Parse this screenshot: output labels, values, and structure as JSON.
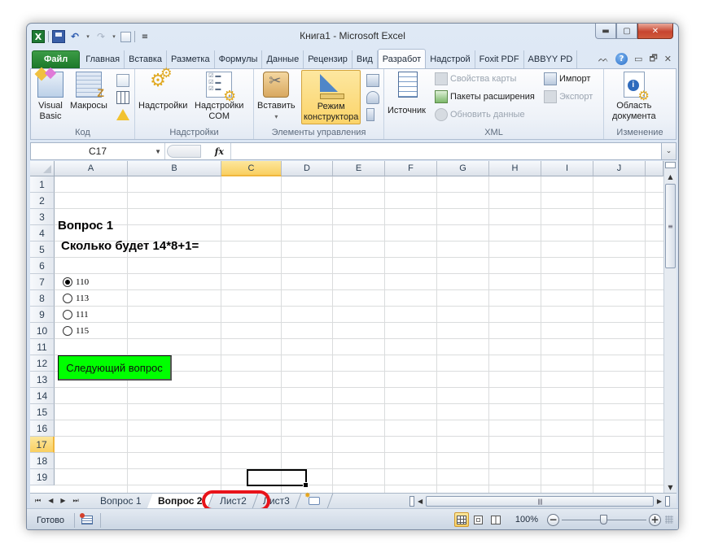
{
  "window": {
    "title": "Книга1  -  Microsoft Excel",
    "controls": {
      "minimize": "▬",
      "restore": "▢",
      "close": "✕"
    }
  },
  "qat": {
    "excel_logo": "X",
    "undo": "↶",
    "redo": "↷",
    "dropdown": "▾",
    "customize": "≡"
  },
  "tabs": [
    {
      "label": "Файл",
      "kind": "file"
    },
    {
      "label": "Главная"
    },
    {
      "label": "Вставка"
    },
    {
      "label": "Разметка"
    },
    {
      "label": "Формулы"
    },
    {
      "label": "Данные"
    },
    {
      "label": "Рецензир"
    },
    {
      "label": "Вид"
    },
    {
      "label": "Разработ",
      "active": true
    },
    {
      "label": "Надстрой"
    },
    {
      "label": "Foxit PDF"
    },
    {
      "label": "ABBYY PD"
    }
  ],
  "tab_right": {
    "collapse": "ᨓ",
    "help": "?",
    "min": "▭",
    "restore": "🗗",
    "close": "✕"
  },
  "ribbon": {
    "groups": {
      "code": {
        "label": "Код",
        "visual_basic": "Visual\nBasic",
        "visual_basic_l1": "Visual",
        "visual_basic_l2": "Basic",
        "macros": "Макросы"
      },
      "addins": {
        "label": "Надстройки",
        "addins_btn": "Надстройки",
        "com_l1": "Надстройки",
        "com_l2": "COM"
      },
      "controls": {
        "label": "Элементы управления",
        "insert": "Вставить",
        "insert_dd": "▾",
        "design_l1": "Режим",
        "design_l2": "конструктора",
        "design_pressed": true
      },
      "xml": {
        "label": "XML",
        "source": "Источник",
        "map_properties": "Свойства карты",
        "expansion_packs": "Пакеты расширения",
        "refresh_data": "Обновить данные",
        "import": "Импорт",
        "export": "Экспорт"
      },
      "modify": {
        "label": "Изменение",
        "doc_panel_l1": "Область",
        "doc_panel_l2": "документа"
      }
    }
  },
  "formula_bar": {
    "name_box": "C17",
    "fx": "fx",
    "formula": "",
    "expand": "⌄"
  },
  "grid": {
    "columns": [
      "A",
      "B",
      "C",
      "D",
      "E",
      "F",
      "G",
      "H",
      "I",
      "J"
    ],
    "selected_column": "C",
    "rows": [
      "1",
      "2",
      "3",
      "4",
      "5",
      "6",
      "7",
      "8",
      "9",
      "10",
      "11",
      "12",
      "13",
      "14",
      "15",
      "16",
      "17",
      "18",
      "19"
    ],
    "selected_row": "17",
    "selected_cell": "C17",
    "cells": {
      "A2": "Вопрос 1",
      "A3": "Сколько будет 14*8+1="
    },
    "radio_options": [
      {
        "label": "110",
        "checked": true
      },
      {
        "label": "113",
        "checked": false
      },
      {
        "label": "111",
        "checked": false
      },
      {
        "label": "115",
        "checked": false
      }
    ],
    "next_button": "Следующий вопрос"
  },
  "sheets": {
    "nav": [
      "⏮",
      "◀",
      "▶",
      "⏭"
    ],
    "tabs": [
      {
        "label": "Вопрос 1"
      },
      {
        "label": "Вопрос 2",
        "active": true,
        "highlighted": true
      },
      {
        "label": "Лист2"
      },
      {
        "label": "Лист3"
      }
    ],
    "scroll_grip": "||||"
  },
  "status_bar": {
    "status": "Готово",
    "zoom": "100%",
    "zoom_percent": 100,
    "zoom_minus": "−",
    "zoom_plus": "+",
    "view_active": "normal"
  },
  "scrollbar": {
    "up": "▲",
    "down": "▼",
    "grip": "≡",
    "left": "◀",
    "right": "▶"
  },
  "accent_colors": {
    "file_tab": "#1d7a2b",
    "selection_header": "#f9cf61",
    "next_button": "#00ff00",
    "highlight_ring": "#e8141a"
  }
}
